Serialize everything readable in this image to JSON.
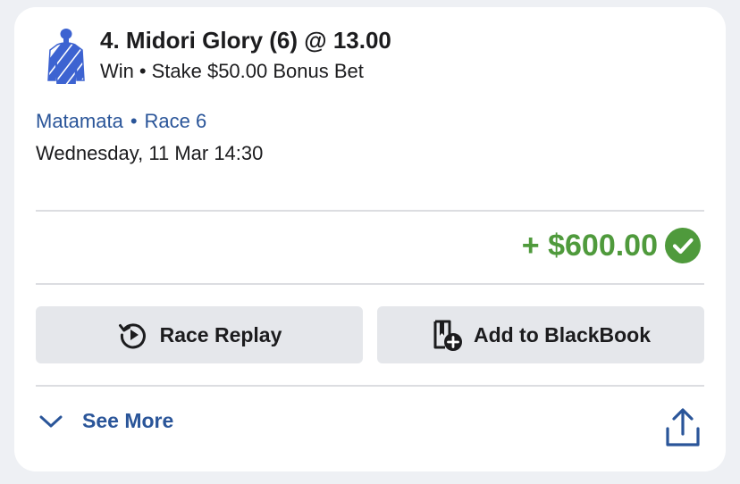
{
  "bet": {
    "runner_title": "4. Midori Glory (6) @ 13.00",
    "bet_type": "Win",
    "separator": "•",
    "stake_text": "Stake $50.00 Bonus Bet",
    "silks_colors": {
      "primary": "#3d63d1",
      "secondary": "#ffffff"
    }
  },
  "race": {
    "venue": "Matamata",
    "separator": "•",
    "race_name": "Race 6",
    "datetime": "Wednesday, 11 Mar 14:30"
  },
  "result": {
    "payout": "+ $600.00",
    "status_icon": "check-circle-icon",
    "color": "#4f9a3c"
  },
  "actions": {
    "replay_label": "Race Replay",
    "replay_icon": "replay-icon",
    "blackbook_label": "Add to BlackBook",
    "blackbook_icon": "blackbook-add-icon"
  },
  "footer": {
    "see_more_label": "See More",
    "see_more_icon": "chevron-down-icon",
    "share_icon": "share-icon",
    "link_color": "#2a5599"
  }
}
